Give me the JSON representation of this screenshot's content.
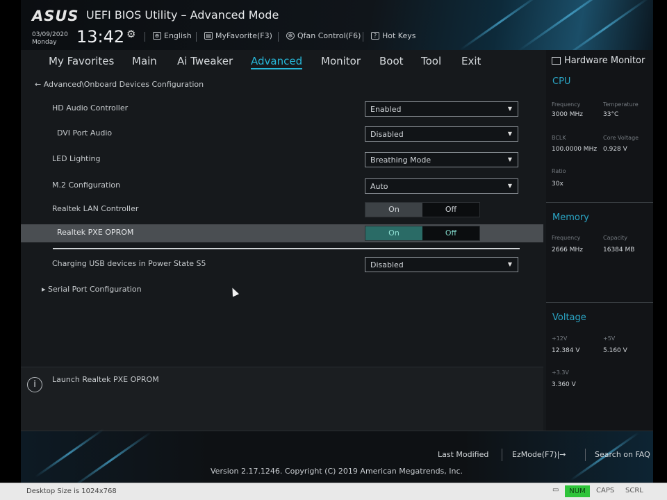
{
  "header": {
    "brand": "ASUS",
    "app_title": "UEFI BIOS Utility – Advanced Mode",
    "date": "03/09/2020",
    "weekday": "Monday",
    "time": "13:42",
    "buttons": [
      {
        "label": "English",
        "icon": "globe-icon"
      },
      {
        "label": "MyFavorite(F3)",
        "icon": "favorite-icon"
      },
      {
        "label": "Qfan Control(F6)",
        "icon": "fan-icon"
      },
      {
        "label": "Hot Keys",
        "icon": "help-icon"
      }
    ]
  },
  "tabs": [
    "My Favorites",
    "Main",
    "Ai Tweaker",
    "Advanced",
    "Monitor",
    "Boot",
    "Tool",
    "Exit"
  ],
  "active_tab": "Advanced",
  "breadcrumb": "Advanced\\Onboard Devices Configuration",
  "settings": [
    {
      "label": "HD Audio Controller",
      "type": "dropdown",
      "value": "Enabled"
    },
    {
      "label": "DVI Port Audio",
      "type": "dropdown",
      "value": "Disabled"
    },
    {
      "label": "LED Lighting",
      "type": "dropdown",
      "value": "Breathing Mode"
    },
    {
      "label": "M.2 Configuration",
      "type": "dropdown",
      "value": "Auto"
    },
    {
      "label": "Realtek LAN Controller",
      "type": "toggle",
      "on": "On",
      "off": "Off",
      "value": "On"
    },
    {
      "label": "Realtek PXE OPROM",
      "type": "toggle",
      "on": "On",
      "off": "Off",
      "value": "On"
    },
    {
      "label": "Charging USB devices in Power State S5",
      "type": "dropdown",
      "value": "Disabled"
    }
  ],
  "submenu": "Serial Port Configuration",
  "help_text": "Launch Realtek PXE OPROM",
  "hardware_monitor": {
    "title": "Hardware Monitor",
    "cpu": {
      "heading": "CPU",
      "frequency_label": "Frequency",
      "frequency": "3000 MHz",
      "temperature_label": "Temperature",
      "temperature": "33°C",
      "bclk_label": "BCLK",
      "bclk": "100.0000 MHz",
      "core_voltage_label": "Core Voltage",
      "core_voltage": "0.928 V",
      "ratio_label": "Ratio",
      "ratio": "30x"
    },
    "memory": {
      "heading": "Memory",
      "frequency_label": "Frequency",
      "frequency": "2666 MHz",
      "capacity_label": "Capacity",
      "capacity": "16384 MB"
    },
    "voltage": {
      "heading": "Voltage",
      "v12_label": "+12V",
      "v12": "12.384 V",
      "v5_label": "+5V",
      "v5": "5.160 V",
      "v33_label": "+3.3V",
      "v33": "3.360 V"
    }
  },
  "footer": {
    "last_modified": "Last Modified",
    "ezmode": "EzMode(F7)|→",
    "search": "Search on FAQ",
    "version": "Version 2.17.1246. Copyright (C) 2019 American Megatrends, Inc."
  },
  "taskbar": {
    "status": "Desktop Size is 1024x768",
    "num": "NUM",
    "caps": "CAPS",
    "scrl": "SCRL"
  },
  "colors": {
    "accent": "#27b6d7",
    "toggle_teal": "#2a6b66",
    "num_indicator": "#2ec43a"
  }
}
